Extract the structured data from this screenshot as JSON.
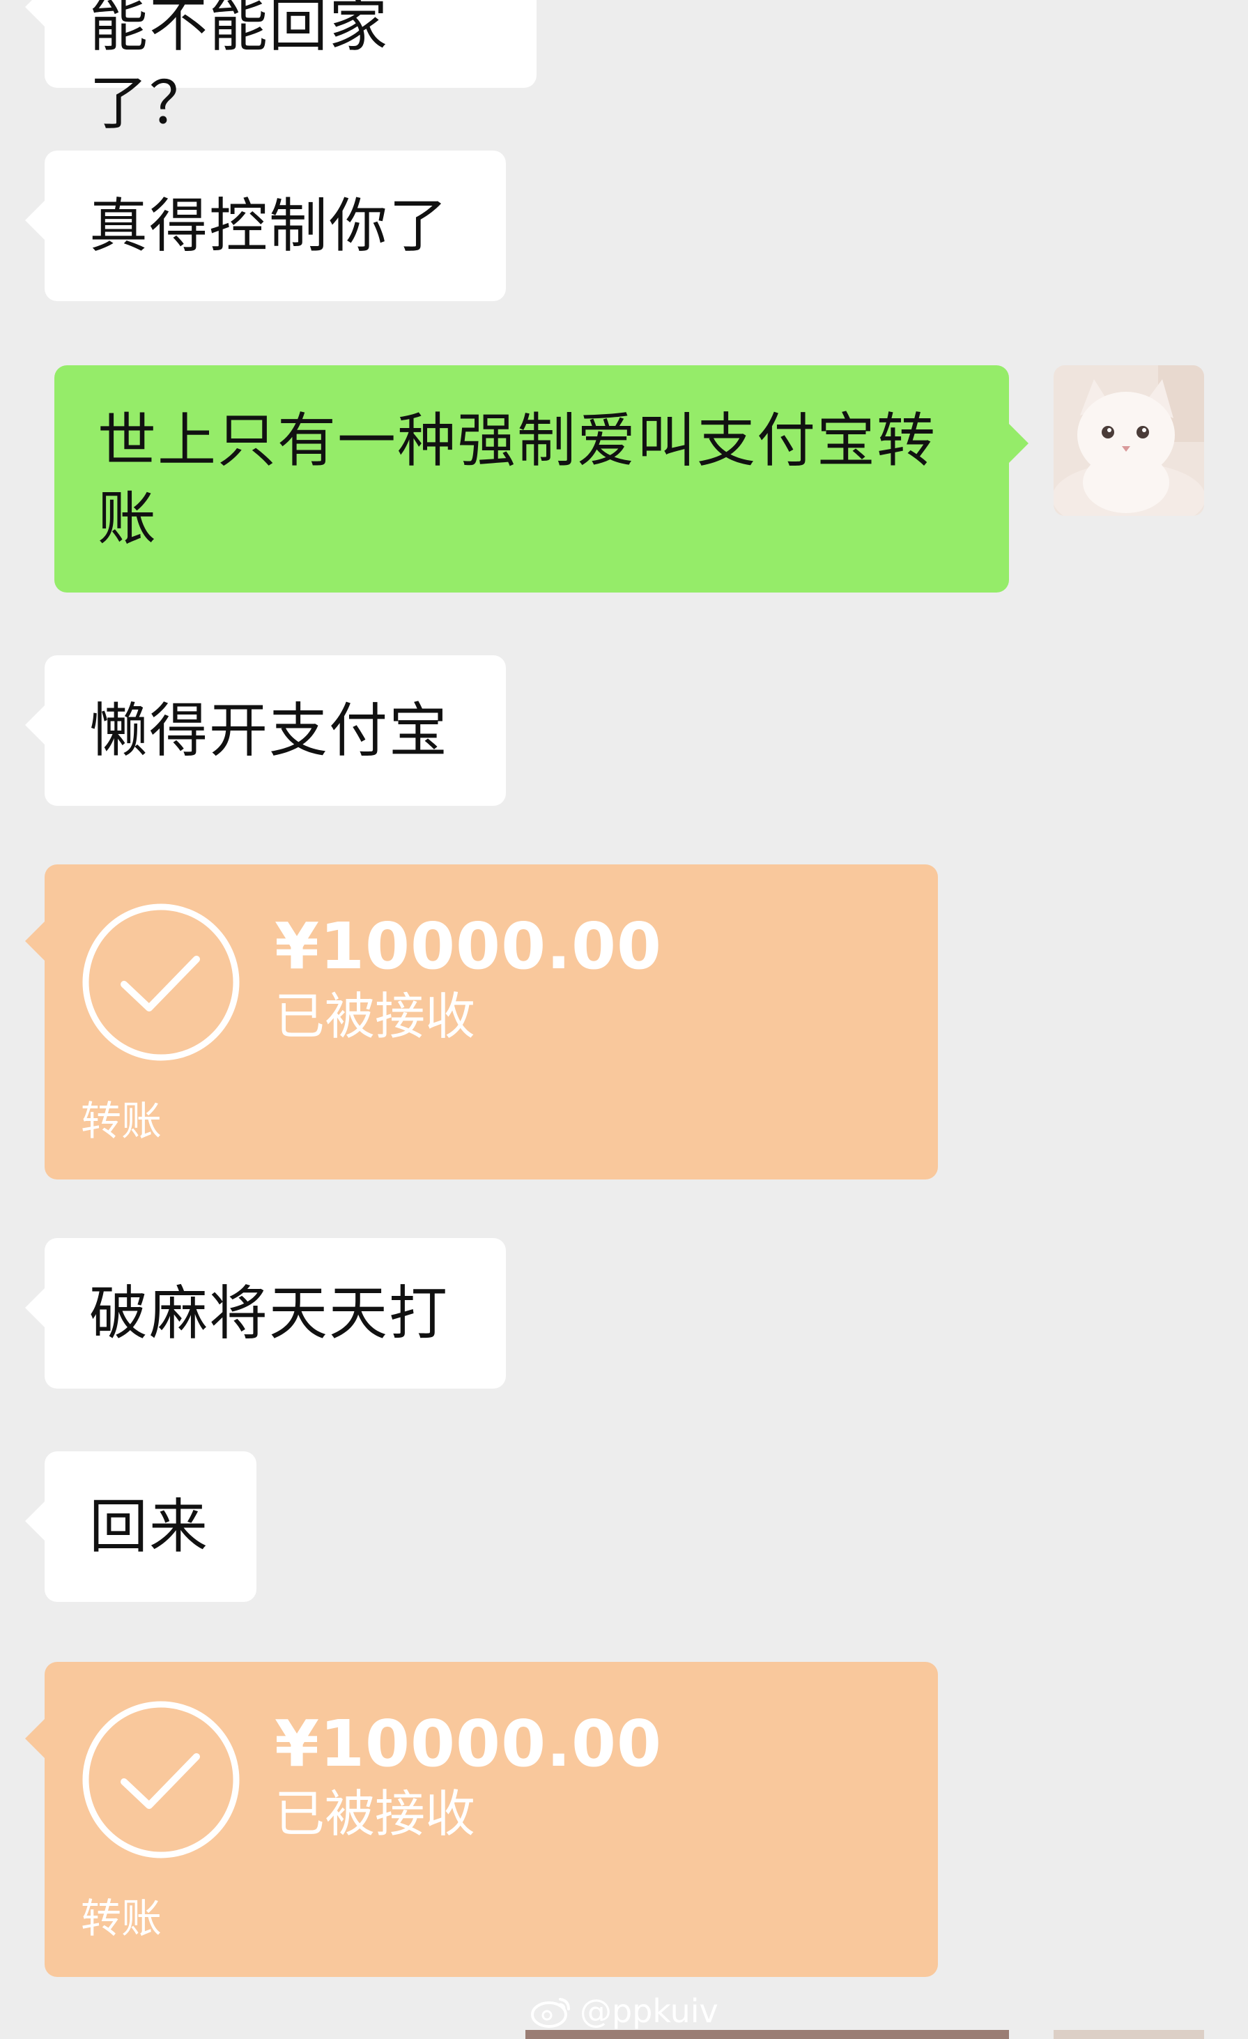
{
  "messages": [
    {
      "type": "text",
      "side": "left",
      "text": "能不能回家了？"
    },
    {
      "type": "text",
      "side": "left",
      "text": "真得控制你了"
    },
    {
      "type": "text",
      "side": "right",
      "text": "世上只有一种强制爱叫支付宝转账"
    },
    {
      "type": "text",
      "side": "left",
      "text": "懒得开支付宝"
    },
    {
      "type": "transfer",
      "side": "left",
      "amount": "¥10000.00",
      "status": "已被接收",
      "label": "转账"
    },
    {
      "type": "text",
      "side": "left",
      "text": "破麻将天天打"
    },
    {
      "type": "text",
      "side": "left",
      "text": "回来"
    },
    {
      "type": "transfer",
      "side": "left",
      "amount": "¥10000.00",
      "status": "已被接收",
      "label": "转账"
    }
  ],
  "watermark": "@ppkuiv",
  "icons": {
    "avatar": "white-kitten-avatar",
    "transfer": "check-circle-icon",
    "watermark": "weibo-icon"
  },
  "colors": {
    "background": "#ededed",
    "incoming_bubble": "#ffffff",
    "outgoing_bubble": "#95ec69",
    "transfer_card": "#f9c89c"
  }
}
